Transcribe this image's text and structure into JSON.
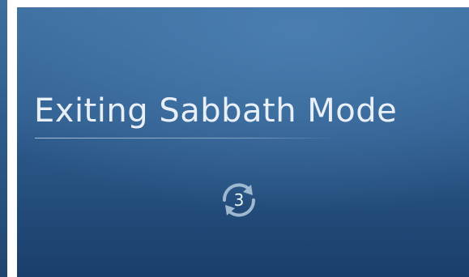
{
  "screen": {
    "title": "Exiting Sabbath Mode",
    "countdown": "3"
  },
  "icons": {
    "countdown_icon": "refresh-cycle-icon"
  },
  "colors": {
    "background_top": "#3d6e9f",
    "background_bottom": "#1b3f6c",
    "text": "#e9eff6"
  }
}
